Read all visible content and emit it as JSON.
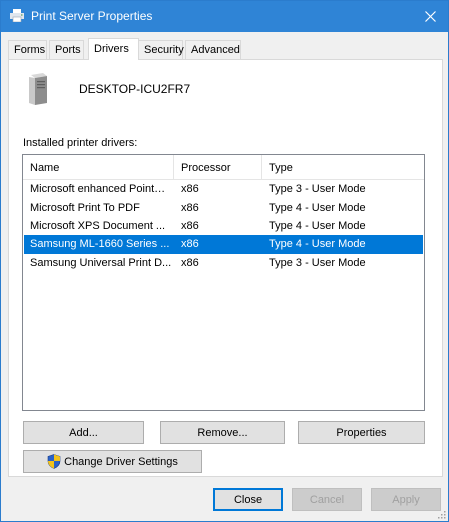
{
  "window": {
    "title": "Print Server Properties",
    "close_glyph": "✕",
    "icon": "printer-icon"
  },
  "tabs": [
    {
      "label": "Forms"
    },
    {
      "label": "Ports"
    },
    {
      "label": "Drivers"
    },
    {
      "label": "Security"
    },
    {
      "label": "Advanced"
    }
  ],
  "active_tab": "Drivers",
  "server": {
    "name": "DESKTOP-ICU2FR7",
    "icon": "server-tower-icon"
  },
  "drivers": {
    "label": "Installed printer drivers:",
    "columns": [
      "Name",
      "Processor",
      "Type"
    ],
    "rows": [
      {
        "name": "Microsoft enhanced Point…",
        "processor": "x86",
        "type": "Type 3 - User Mode"
      },
      {
        "name": "Microsoft Print To PDF",
        "processor": "x86",
        "type": "Type 4 - User Mode"
      },
      {
        "name": "Microsoft XPS Document ...",
        "processor": "x86",
        "type": "Type 4 - User Mode"
      },
      {
        "name": "Samsung ML-1660 Series ...",
        "processor": "x86",
        "type": "Type 4 - User Mode"
      },
      {
        "name": "Samsung Universal Print D...",
        "processor": "x86",
        "type": "Type 3 - User Mode"
      }
    ],
    "selected_index": 3
  },
  "actions": {
    "add": "Add...",
    "remove": "Remove...",
    "properties": "Properties",
    "change_settings": "Change Driver Settings"
  },
  "footer": {
    "close": "Close",
    "cancel": "Cancel",
    "apply": "Apply"
  },
  "colors": {
    "titlebar": "#2f84d6",
    "selection": "#0078d7"
  }
}
